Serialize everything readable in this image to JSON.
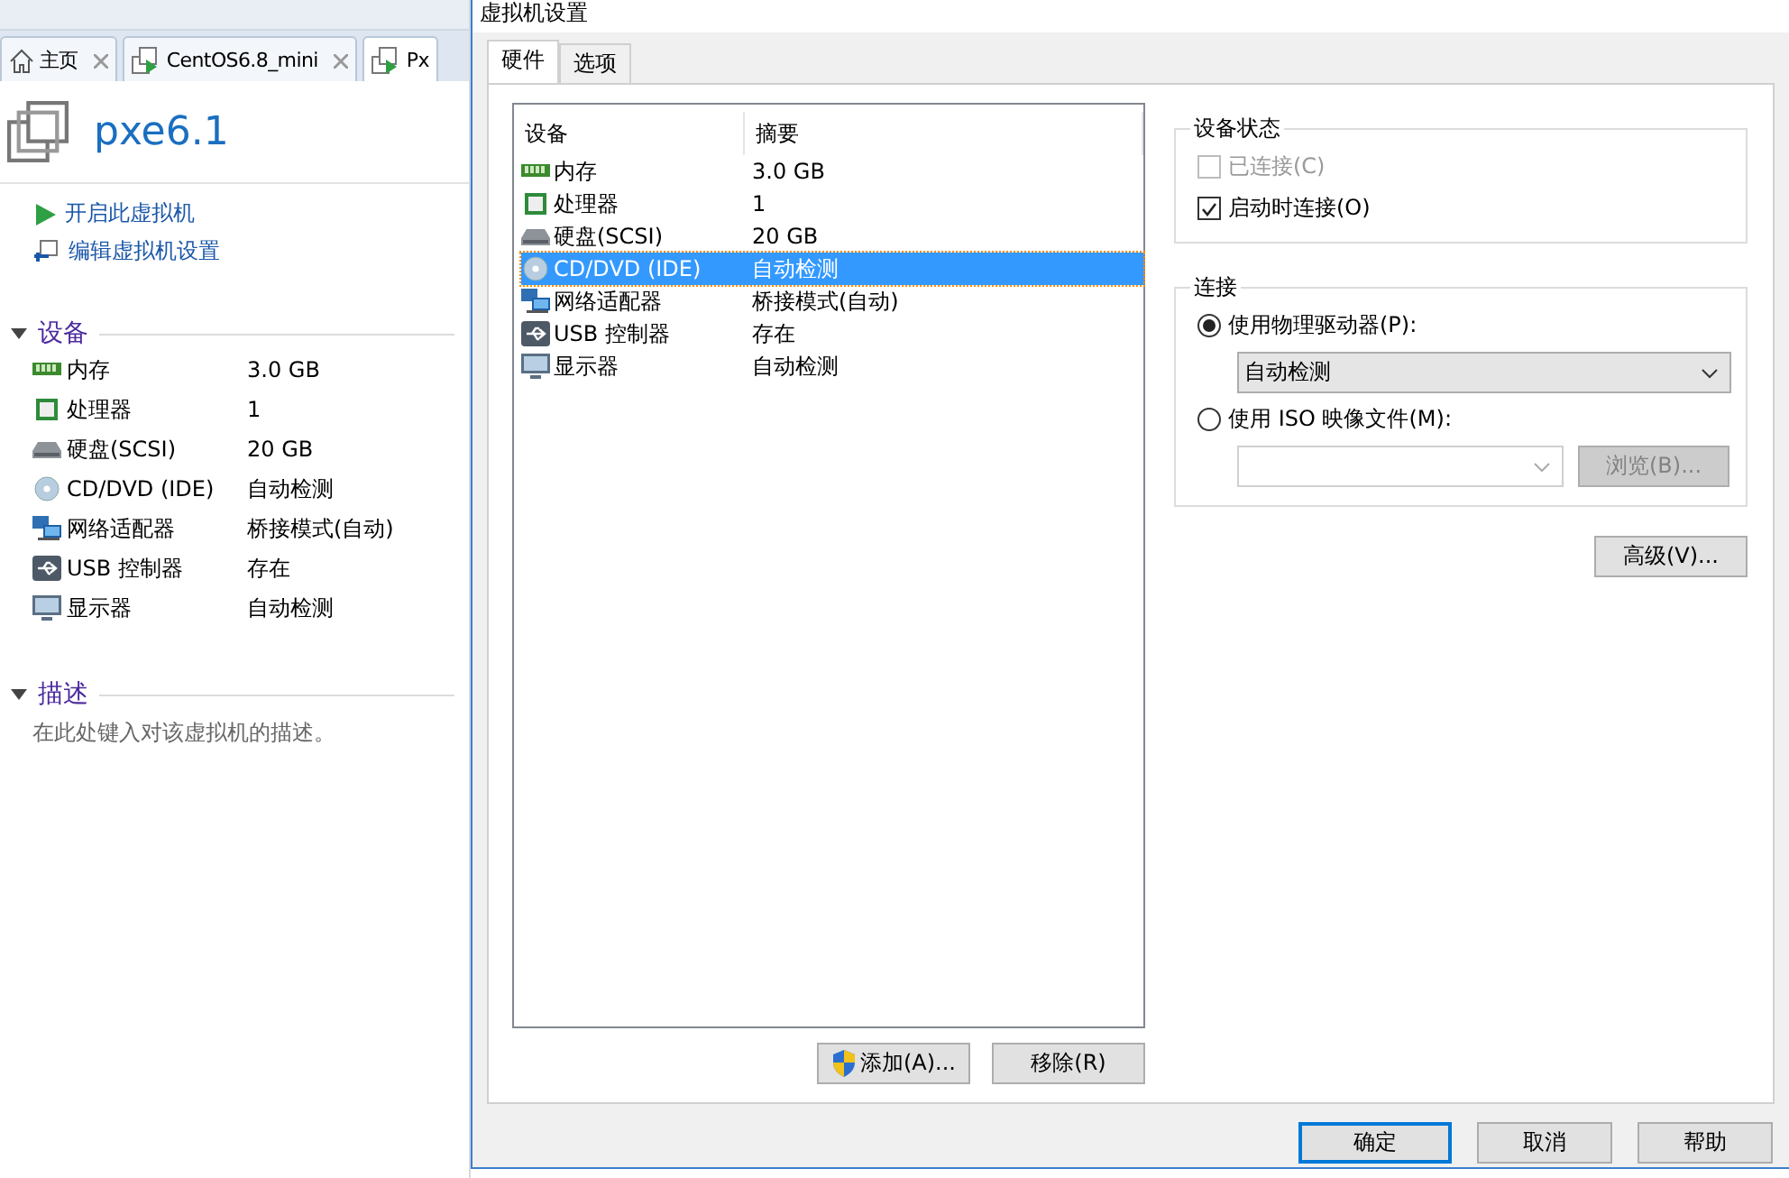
{
  "tabs": [
    {
      "label": "主页",
      "kind": "home",
      "selected": false
    },
    {
      "label": "CentOS6.8_mini",
      "kind": "vm",
      "selected": false
    },
    {
      "label": "Px",
      "kind": "vm",
      "selected": true
    }
  ],
  "vm": {
    "name": "pxe6.1",
    "actions": [
      {
        "label": "开启此虚拟机",
        "kind": "power"
      },
      {
        "label": "编辑虚拟机设置",
        "kind": "edit"
      }
    ],
    "devices_section": {
      "title": "设备",
      "expanded": true,
      "items": [
        {
          "kind": "memory",
          "name": "内存",
          "summary": "3.0 GB"
        },
        {
          "kind": "cpu",
          "name": "处理器",
          "summary": "1"
        },
        {
          "kind": "disk",
          "name": "硬盘(SCSI)",
          "summary": "20 GB"
        },
        {
          "kind": "cdrom",
          "name": "CD/DVD (IDE)",
          "summary": "自动检测"
        },
        {
          "kind": "network",
          "name": "网络适配器",
          "summary": "桥接模式(自动)"
        },
        {
          "kind": "usb",
          "name": "USB 控制器",
          "summary": "存在"
        },
        {
          "kind": "display",
          "name": "显示器",
          "summary": "自动检测"
        }
      ]
    },
    "description_section": {
      "title": "描述",
      "expanded": true,
      "hint": "在此处键入对该虚拟机的描述。"
    }
  },
  "dialog": {
    "title": "虚拟机设置",
    "tabs": [
      {
        "label": "硬件",
        "selected": true
      },
      {
        "label": "选项",
        "selected": false
      }
    ],
    "device_list": {
      "columns": [
        "设备",
        "摘要"
      ],
      "rows": [
        {
          "kind": "memory",
          "name": "内存",
          "summary": "3.0 GB",
          "selected": false
        },
        {
          "kind": "cpu",
          "name": "处理器",
          "summary": "1",
          "selected": false
        },
        {
          "kind": "disk",
          "name": "硬盘(SCSI)",
          "summary": "20 GB",
          "selected": false
        },
        {
          "kind": "cdrom",
          "name": "CD/DVD (IDE)",
          "summary": "自动检测",
          "selected": true
        },
        {
          "kind": "network",
          "name": "网络适配器",
          "summary": "桥接模式(自动)",
          "selected": false
        },
        {
          "kind": "usb",
          "name": "USB 控制器",
          "summary": "存在",
          "selected": false
        },
        {
          "kind": "display",
          "name": "显示器",
          "summary": "自动检测",
          "selected": false
        }
      ]
    },
    "add_button": "添加(A)...",
    "remove_button": "移除(R)",
    "device_status": {
      "title": "设备状态",
      "options": [
        {
          "label": "已连接(C)",
          "checked": false,
          "disabled": true
        },
        {
          "label": "启动时连接(O)",
          "checked": true,
          "disabled": false
        }
      ]
    },
    "connection": {
      "title": "连接",
      "options": [
        {
          "label": "使用物理驱动器(P):",
          "selected": true,
          "value": "自动检测"
        },
        {
          "label": "使用 ISO 映像文件(M):",
          "selected": false
        }
      ],
      "browse_button": "浏览(B)..."
    },
    "advanced_button": "高级(V)...",
    "buttons": [
      {
        "label": "确定",
        "default": true
      },
      {
        "label": "取消",
        "default": false
      },
      {
        "label": "帮助",
        "default": false
      }
    ]
  }
}
